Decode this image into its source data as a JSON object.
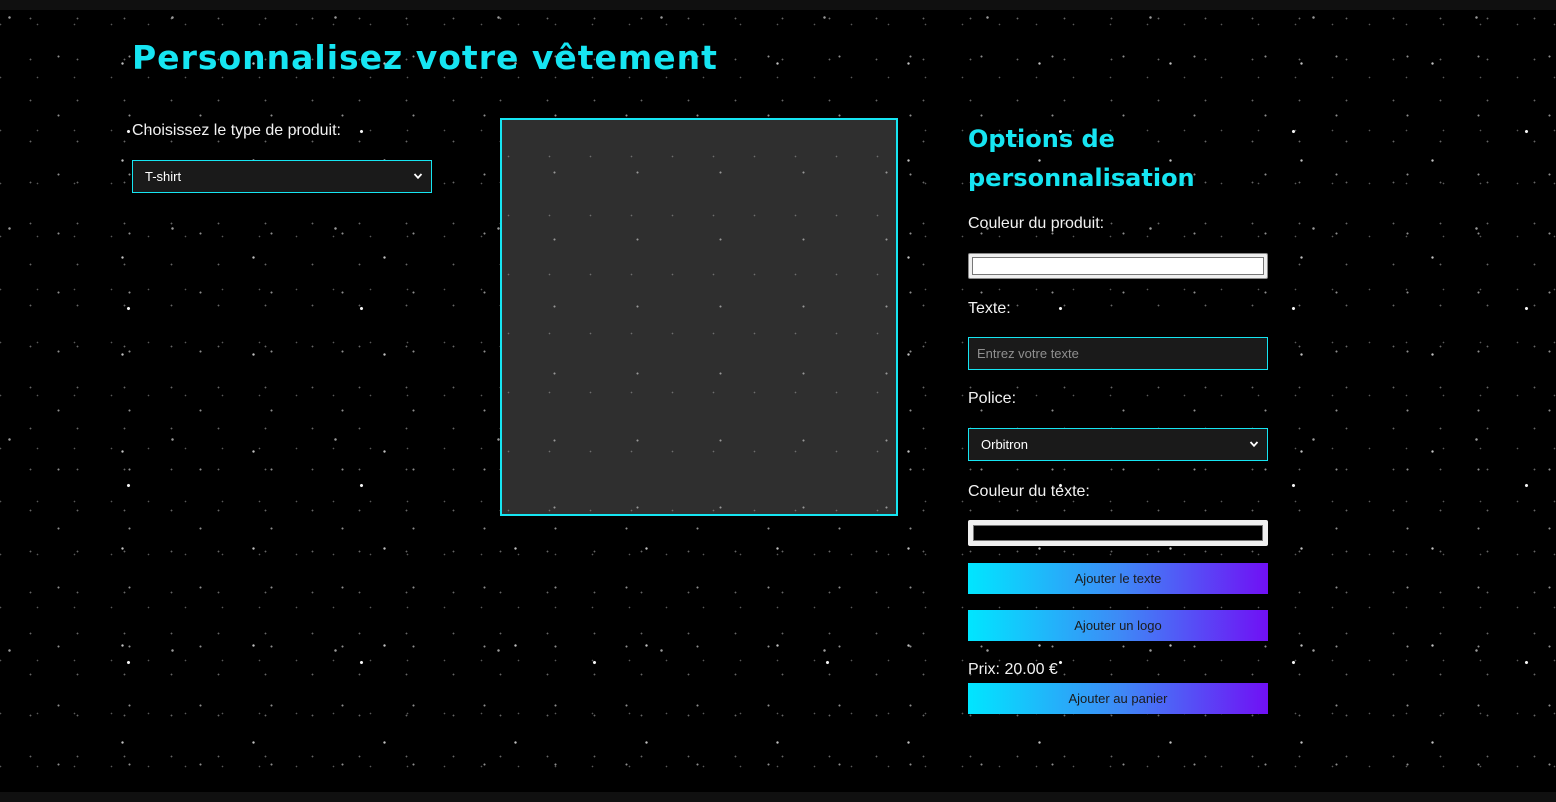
{
  "page": {
    "title": "Personnalisez votre vêtement"
  },
  "product": {
    "label": "Choisissez le type de produit:",
    "selected": "T-shirt"
  },
  "options": {
    "heading": "Options de personnalisation",
    "product_color_label": "Couleur du produit:",
    "product_color_value": "#ffffff",
    "text_label": "Texte:",
    "text_placeholder": "Entrez votre texte",
    "text_value": "",
    "font_label": "Police:",
    "font_selected": "Orbitron",
    "text_color_label": "Couleur du texte:",
    "text_color_value": "#000000",
    "add_text_button": "Ajouter le texte",
    "add_logo_button": "Ajouter un logo",
    "price_text": "Prix: 20.00 €",
    "add_to_cart_button": "Ajouter au panier"
  },
  "colors": {
    "accent": "#16e5f2",
    "background": "#000000",
    "canvas_background": "#2f2f2f",
    "button_gradient_start": "#00e6ff",
    "button_gradient_end": "#7010f5"
  },
  "icons": {
    "select_arrow": "chevron-down-icon"
  }
}
